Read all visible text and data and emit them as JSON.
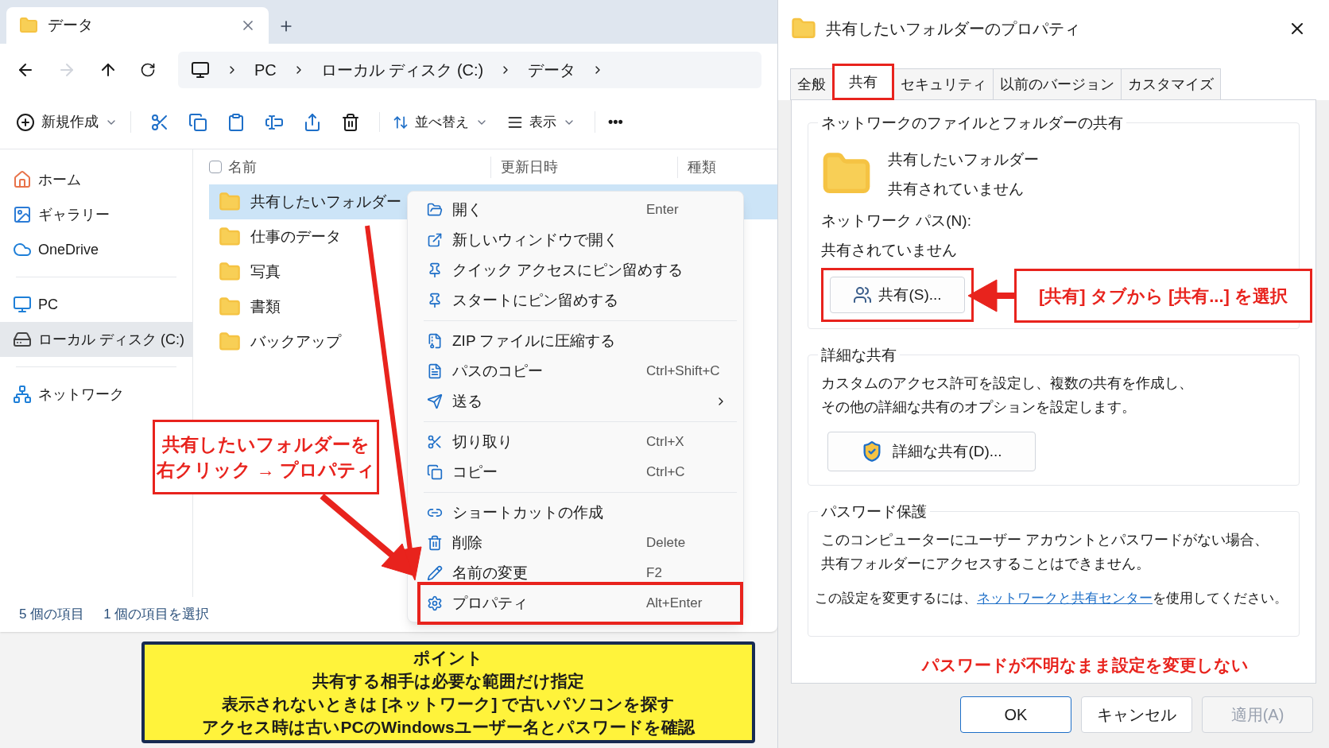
{
  "explorer": {
    "tab_title": "データ",
    "breadcrumb": [
      "PC",
      "ローカル ディスク (C:)",
      "データ"
    ],
    "toolbar": {
      "new": "新規作成",
      "sort": "並べ替え",
      "view": "表示",
      "more": "•••"
    },
    "sidebar": [
      {
        "label": "ホーム",
        "selected": false
      },
      {
        "label": "ギャラリー",
        "selected": false
      },
      {
        "label": "OneDrive",
        "selected": false
      },
      {
        "label": "PC",
        "selected": false
      },
      {
        "label": "ローカル ディスク (C:)",
        "selected": true
      },
      {
        "label": "ネットワーク",
        "selected": false
      }
    ],
    "columns": [
      "名前",
      "更新日時",
      "種類"
    ],
    "files": [
      {
        "name": "共有したいフォルダー",
        "selected": true
      },
      {
        "name": "仕事のデータ",
        "selected": false
      },
      {
        "name": "写真",
        "selected": false
      },
      {
        "name": "書類",
        "selected": false
      },
      {
        "name": "バックアップ",
        "selected": false
      }
    ],
    "status": [
      "5 個の項目",
      "1 個の項目を選択"
    ]
  },
  "context_menu": {
    "groups": [
      [
        {
          "label": "開く",
          "shortcut": "Enter",
          "submenu": false
        },
        {
          "label": "新しいウィンドウで開く",
          "submenu": false
        },
        {
          "label": "クイック アクセスにピン留めする",
          "submenu": false
        },
        {
          "label": "スタートにピン留めする",
          "submenu": false
        }
      ],
      [
        {
          "label": "ZIP ファイルに圧縮する",
          "submenu": false
        },
        {
          "label": "パスのコピー",
          "shortcut": "Ctrl+Shift+C",
          "submenu": false
        },
        {
          "label": "送る",
          "submenu": true
        }
      ],
      [
        {
          "label": "切り取り",
          "shortcut": "Ctrl+X",
          "submenu": false
        },
        {
          "label": "コピー",
          "shortcut": "Ctrl+C",
          "submenu": false
        }
      ],
      [
        {
          "label": "ショートカットの作成",
          "submenu": false
        },
        {
          "label": "削除",
          "shortcut": "Delete",
          "submenu": false
        },
        {
          "label": "名前の変更",
          "shortcut": "F2",
          "submenu": false
        },
        {
          "label": "プロパティ",
          "shortcut": "Alt+Enter",
          "submenu": false,
          "highlighted": true
        }
      ]
    ]
  },
  "dialog": {
    "title": "共有したいフォルダーのプロパティ",
    "tabs": [
      {
        "label": "全般",
        "selected": false,
        "highlighted": false
      },
      {
        "label": "共有",
        "selected": true,
        "highlighted": true
      },
      {
        "label": "セキュリティ",
        "selected": false,
        "highlighted": false
      },
      {
        "label": "以前のバージョン",
        "selected": false,
        "highlighted": false
      },
      {
        "label": "カスタマイズ",
        "selected": false,
        "highlighted": false
      }
    ],
    "network_sharing": {
      "title": "ネットワークのファイルとフォルダーの共有",
      "folder_name": "共有したいフォルダー",
      "folder_status": "共有されていません",
      "path_label": "ネットワーク パス(N):",
      "path_value": "共有されていません",
      "button": "共有(S)...",
      "button_highlighted": true
    },
    "advanced_sharing": {
      "title": "詳細な共有",
      "description": [
        "カスタムのアクセス許可を設定し、複数の共有を作成し、",
        "その他の詳細な共有のオプションを設定します。"
      ],
      "button": "詳細な共有(D)..."
    },
    "password_protection": {
      "title": "パスワード保護",
      "description": [
        "このコンピューターにユーザー アカウントとパスワードがない場合、",
        "共有フォルダーにアクセスすることはできません。"
      ],
      "link_before": "この設定を変更するには、",
      "link": "ネットワークと共有センター",
      "link_after": "を使用してください。"
    },
    "warning": "パスワードが不明なまま設定を変更しない",
    "buttons": [
      {
        "label": "OK",
        "disabled": false
      },
      {
        "label": "キャンセル",
        "disabled": false
      },
      {
        "label": "適用(A)",
        "disabled": true
      }
    ]
  },
  "callouts": {
    "right_click": [
      "共有したいフォルダーを",
      "右クリック → プロパティ"
    ],
    "share_tab": "[共有] タブから [共有...] を選択"
  },
  "point_box": {
    "title": "ポイント",
    "lines": [
      "共有する相手は必要な範囲だけ指定",
      "表示されないときは [ネットワーク] で古いパソコンを探す",
      "アクセス時は古いPCのWindowsユーザー名とパスワードを確認"
    ]
  }
}
